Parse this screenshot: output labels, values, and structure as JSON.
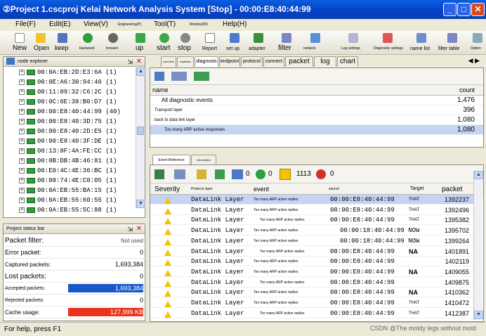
{
  "title": "Project 1.cscproj Kelai Network Analysis System [Stop] - 00:00:E8:40:44:99",
  "window_buttons": {
    "minimize": "_",
    "maximize": "□",
    "close": "✕"
  },
  "menu": [
    "File(F)",
    "Edit(E)",
    "View(V)",
    "Engineering(P)",
    "Tool(T)",
    "Window(W)",
    "Help(H)"
  ],
  "toolbar": {
    "new": "New",
    "open": "Open",
    "keep": "keep",
    "backward": "backward",
    "forward": "forward",
    "up": "up",
    "start": "start",
    "stop": "stop",
    "report": "Report",
    "setup": "set up",
    "adapter": "adapter",
    "filter": "filter",
    "network": "network",
    "log_settings": "Log settings",
    "diagnostic_settings": "Diagnostic settings",
    "name_list": "name list",
    "filter_table": "filter table",
    "options": "Option"
  },
  "node_explorer": {
    "title": "node explorer",
    "nodes": [
      {
        "mac": "00:0A:EB:2D:E3:6A",
        "count": "(1)"
      },
      {
        "mac": "00:0E:A6:30:94:46",
        "count": "(1)"
      },
      {
        "mac": "00:11:09:32:C6:2C",
        "count": "(1)"
      },
      {
        "mac": "00:0C:6E:38:B0:D7",
        "count": "(1)"
      },
      {
        "mac": "00:00:E8:40:44:99",
        "count": "(40)"
      },
      {
        "mac": "00:00:E8:40:3D:75",
        "count": "(1)"
      },
      {
        "mac": "00:00:E8:40:2D:E5",
        "count": "(1)"
      },
      {
        "mac": "00:00:E8:40:3F:DE",
        "count": "(1)"
      },
      {
        "mac": "00:13:8F:4A:FE:CC",
        "count": "(1)"
      },
      {
        "mac": "00:0B:DB:4B:46:81",
        "count": "(1)"
      },
      {
        "mac": "00:E0:4C:4E:36:BC",
        "count": "(1)"
      },
      {
        "mac": "00:08:74:4E:C0:05",
        "count": "(1)"
      },
      {
        "mac": "00:0A:EB:55:BA:15",
        "count": "(1)"
      },
      {
        "mac": "00:0A:EB:55:60:55",
        "count": "(1)"
      },
      {
        "mac": "00:0A:EB:55:5C:88",
        "count": "(1)"
      }
    ]
  },
  "status_panel": {
    "title": "Project status bar",
    "rows": [
      {
        "label": "Packet filter:",
        "value": "Not used"
      },
      {
        "label": "Error packet:",
        "value": "0"
      },
      {
        "label": "Captured packets:",
        "value": "1,693,384"
      },
      {
        "label": "Lost packets:",
        "value": "0"
      },
      {
        "label": "Accepted packets:",
        "value": "1,693,384"
      },
      {
        "label": "Rejected packets:",
        "value": "0"
      },
      {
        "label": "Cache usage:",
        "value": "127,999 KB"
      }
    ]
  },
  "tabs": [
    "overview",
    "statistics",
    "diagnosis",
    "endpoint",
    "protocol",
    "connect",
    "packet",
    "log",
    "chart"
  ],
  "diagnosis": {
    "header_name": "name",
    "header_count": "count",
    "rows": [
      {
        "name": "All diagnostic events",
        "count": "1,476"
      },
      {
        "name": "Transport layer",
        "count": "396"
      },
      {
        "name": "back to data link layer",
        "count": "1,080"
      },
      {
        "name": "Too many ARP active responses",
        "count": "1,080"
      }
    ]
  },
  "event_ref": {
    "tab1": "Event Reference",
    "tab2": "Information",
    "counts": [
      "0",
      "0",
      "1113",
      "0"
    ],
    "headers": [
      "Severity",
      "Protocol layer",
      "event",
      "source",
      "Target",
      "packet"
    ],
    "rows": [
      {
        "layer": "DataLink Layer",
        "event": "Too many ARP active replies",
        "source": "00:00:E8:40:44:99",
        "target": "THAT",
        "packet": "1392237"
      },
      {
        "layer": "DataLink Layer",
        "event": "Too many ARP active replies",
        "source": "00:00:E8:40:44:99",
        "target": "THAT",
        "packet": "1392496"
      },
      {
        "layer": "DataLink Layer",
        "event": "Too many ARP active replies",
        "source": "00:00:E8:40:44:99",
        "target": "THAT",
        "packet": "1395382"
      },
      {
        "layer": "DataLink Layer",
        "event": "Too many ARP active replies",
        "source": "00:00:18:40:44:99 NOW",
        "target": "",
        "packet": "1395702"
      },
      {
        "layer": "DataLink Layer",
        "event": "Too many ARP active replies",
        "source": "00:00:18:40:44:99 NOW",
        "target": "",
        "packet": "1399264"
      },
      {
        "layer": "DataLink Layer",
        "event": "Too many ARP active replies",
        "source": "00:00:E8:40:44:99",
        "target": "NA",
        "packet": "1401891"
      },
      {
        "layer": "DataLink Layer",
        "event": "Too many ARP active replies",
        "source": "00:00:E8:40:44:99",
        "target": "",
        "packet": "1402119"
      },
      {
        "layer": "DataLink Layer",
        "event": "Too many ARP active replies",
        "source": "00:00:E8:40:44:99",
        "target": "NA",
        "packet": "1409055"
      },
      {
        "layer": "DataLink Layer",
        "event": "Too many ARP active replies",
        "source": "00:00:E8:40:44:99",
        "target": "",
        "packet": "1409875"
      },
      {
        "layer": "DataLink Layer",
        "event": "Too many ARP active replies",
        "source": "00:00:E8:40:44:99",
        "target": "NA",
        "packet": "1410362"
      },
      {
        "layer": "DataLink Layer",
        "event": "Too many ARP active replies",
        "source": "00:00:E8:40:44:99",
        "target": "THAT",
        "packet": "1410472"
      },
      {
        "layer": "DataLink Layer",
        "event": "Too many ARP active replies",
        "source": "00:00:E8:40:44:99",
        "target": "THAT",
        "packet": "1412387"
      }
    ]
  },
  "statusbar": {
    "help": "For help, press F1",
    "watermark": "CSDN @The moldy legs without mold"
  },
  "colors": {
    "title_blue": "#0541c8",
    "selected_row": "#c5d3f4",
    "accepted_bar": "#1757c9",
    "cache_bar": "#e8321a"
  }
}
